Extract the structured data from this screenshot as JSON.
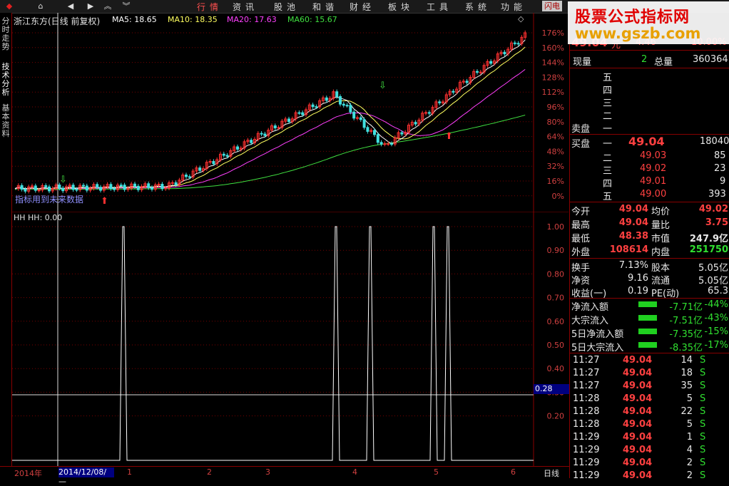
{
  "menu": {
    "items": [
      "行情",
      "资讯",
      "股池",
      "和谐",
      "财经",
      "板块",
      "工具",
      "系统",
      "功能"
    ],
    "flash": "闪电"
  },
  "left_tabs": [
    "分时走势",
    "技术分析",
    "基本资料"
  ],
  "main_chart": {
    "title": "浙江东方(日线 前复权)",
    "ma": [
      {
        "label": "MA5: 18.65",
        "color": "#ffffff"
      },
      {
        "label": "MA10: 18.35",
        "color": "#ffff60"
      },
      {
        "label": "MA20: 17.63",
        "color": "#ff40ff"
      },
      {
        "label": "MA60: 15.67",
        "color": "#40e040"
      }
    ],
    "y_ticks": [
      "176%",
      "160%",
      "144%",
      "128%",
      "112%",
      "96%",
      "80%",
      "64%",
      "48%",
      "32%",
      "16%",
      "0%"
    ],
    "note": "指标用到未来数据"
  },
  "sub_chart": {
    "title": "HH HH: 0.00",
    "y_ticks": [
      "1.00",
      "0.90",
      "0.80",
      "0.70",
      "0.60",
      "0.50",
      "0.40",
      "0.30",
      "0.20"
    ],
    "cursor_value": "0.28"
  },
  "bottom_bar": {
    "year": "2014年",
    "date": "2014/12/08/—",
    "months": [
      "1",
      "2",
      "3",
      "4",
      "5",
      "6"
    ],
    "period": "日线"
  },
  "watermark": {
    "line1": "股票公式指标网",
    "line2": "www.gszb.com"
  },
  "quote": {
    "price_partial": "49.04",
    "unit": "元",
    "change_partial": "4.46",
    "pct_partial": "10.00%",
    "now_vol_label": "现量",
    "now_vol": "2",
    "total_vol_label": "总量",
    "total_vol": "360364",
    "sell_levels": [
      "五",
      "四",
      "三",
      "二",
      "一"
    ],
    "sell_label": "卖盘",
    "buy_label": "买盘",
    "buy": [
      {
        "level": "一",
        "price": "49.04",
        "vol": "18040"
      },
      {
        "level": "二",
        "price": "49.03",
        "vol": "85"
      },
      {
        "level": "三",
        "price": "49.02",
        "vol": "23"
      },
      {
        "level": "四",
        "price": "49.01",
        "vol": "9"
      },
      {
        "level": "五",
        "price": "49.00",
        "vol": "393"
      }
    ],
    "stats": [
      {
        "l1": "今开",
        "v1": "49.04",
        "l2": "均价",
        "v2": "49.02",
        "c1": "red",
        "c2": "red"
      },
      {
        "l1": "最高",
        "v1": "49.04",
        "l2": "量比",
        "v2": "3.75",
        "c1": "red",
        "c2": "red"
      },
      {
        "l1": "最低",
        "v1": "48.38",
        "l2": "市值",
        "v2": "247.9亿",
        "c1": "red",
        "c2": "white"
      },
      {
        "l1": "外盘",
        "v1": "108614",
        "l2": "内盘",
        "v2": "251750",
        "c1": "red",
        "c2": "green"
      }
    ],
    "stats2": [
      {
        "l1": "换手",
        "v1": "7.13%",
        "l2": "股本",
        "v2": "5.05亿"
      },
      {
        "l1": "净资",
        "v1": "9.16",
        "l2": "流通",
        "v2": "5.05亿"
      },
      {
        "l1": "收益(一)",
        "v1": "0.19",
        "l2": "PE(动)",
        "v2": "65.3"
      }
    ],
    "flows": [
      {
        "label": "净流入额",
        "value": "-7.71亿",
        "pct": "-44%"
      },
      {
        "label": "大宗流入",
        "value": "-7.51亿",
        "pct": "-43%"
      },
      {
        "label": "5日净流入额",
        "value": "-7.35亿",
        "pct": "-15%"
      },
      {
        "label": "5日大宗流入",
        "value": "-8.35亿",
        "pct": "-17%"
      }
    ],
    "ticks": [
      {
        "time": "11:27",
        "price": "49.04",
        "vol": "14",
        "side": "S"
      },
      {
        "time": "11:27",
        "price": "49.04",
        "vol": "18",
        "side": "S"
      },
      {
        "time": "11:27",
        "price": "49.04",
        "vol": "35",
        "side": "S"
      },
      {
        "time": "11:28",
        "price": "49.04",
        "vol": "5",
        "side": "S"
      },
      {
        "time": "11:28",
        "price": "49.04",
        "vol": "22",
        "side": "S"
      },
      {
        "time": "11:28",
        "price": "49.04",
        "vol": "5",
        "side": "S"
      },
      {
        "time": "11:29",
        "price": "49.04",
        "vol": "1",
        "side": "S"
      },
      {
        "time": "11:29",
        "price": "49.04",
        "vol": "4",
        "side": "S"
      },
      {
        "time": "11:29",
        "price": "49.04",
        "vol": "2",
        "side": "S"
      },
      {
        "time": "11:29",
        "price": "49.04",
        "vol": "2",
        "side": "S"
      }
    ]
  }
}
